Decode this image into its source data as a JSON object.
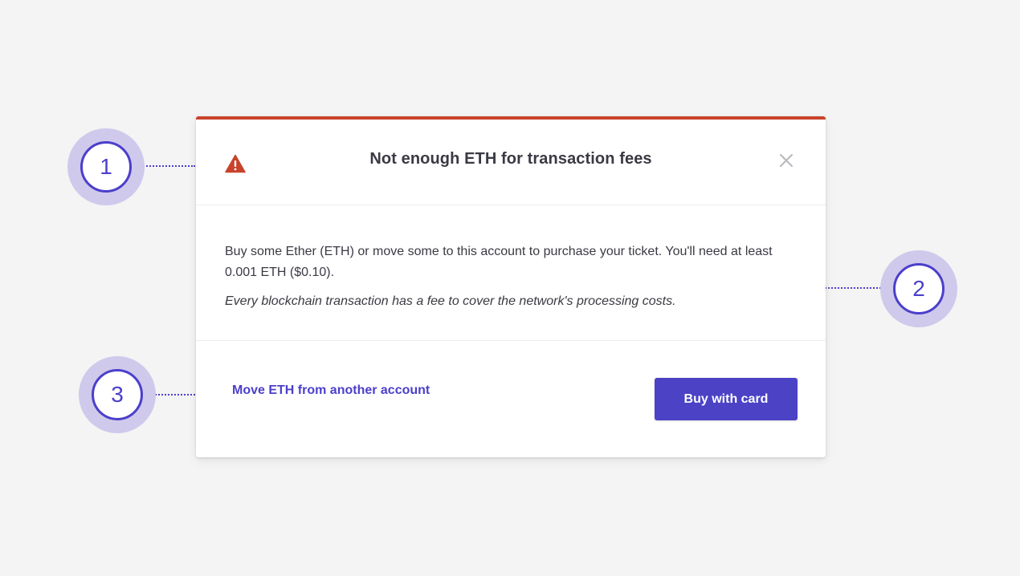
{
  "dialog": {
    "title": "Not enough ETH for transaction fees",
    "icon": "warning-triangle-icon",
    "close_icon": "close-icon",
    "body_text": "Buy some Ether (ETH) or move some to this account to purchase your ticket. You'll need at least 0.001 ETH ($0.10).",
    "body_note": "Every blockchain transaction has a fee to cover the network's processing costs.",
    "secondary_action_label": "Move ETH from another account",
    "primary_action_label": "Buy with card"
  },
  "callouts": [
    {
      "label": "1"
    },
    {
      "label": "2"
    },
    {
      "label": "3"
    }
  ],
  "colors": {
    "background": "#f4f4f4",
    "accent_error": "#c8432b",
    "primary": "#4b42c6",
    "link": "#4b3fcb",
    "callout_halo": "#cfc9ec",
    "text": "#3a3a44"
  }
}
